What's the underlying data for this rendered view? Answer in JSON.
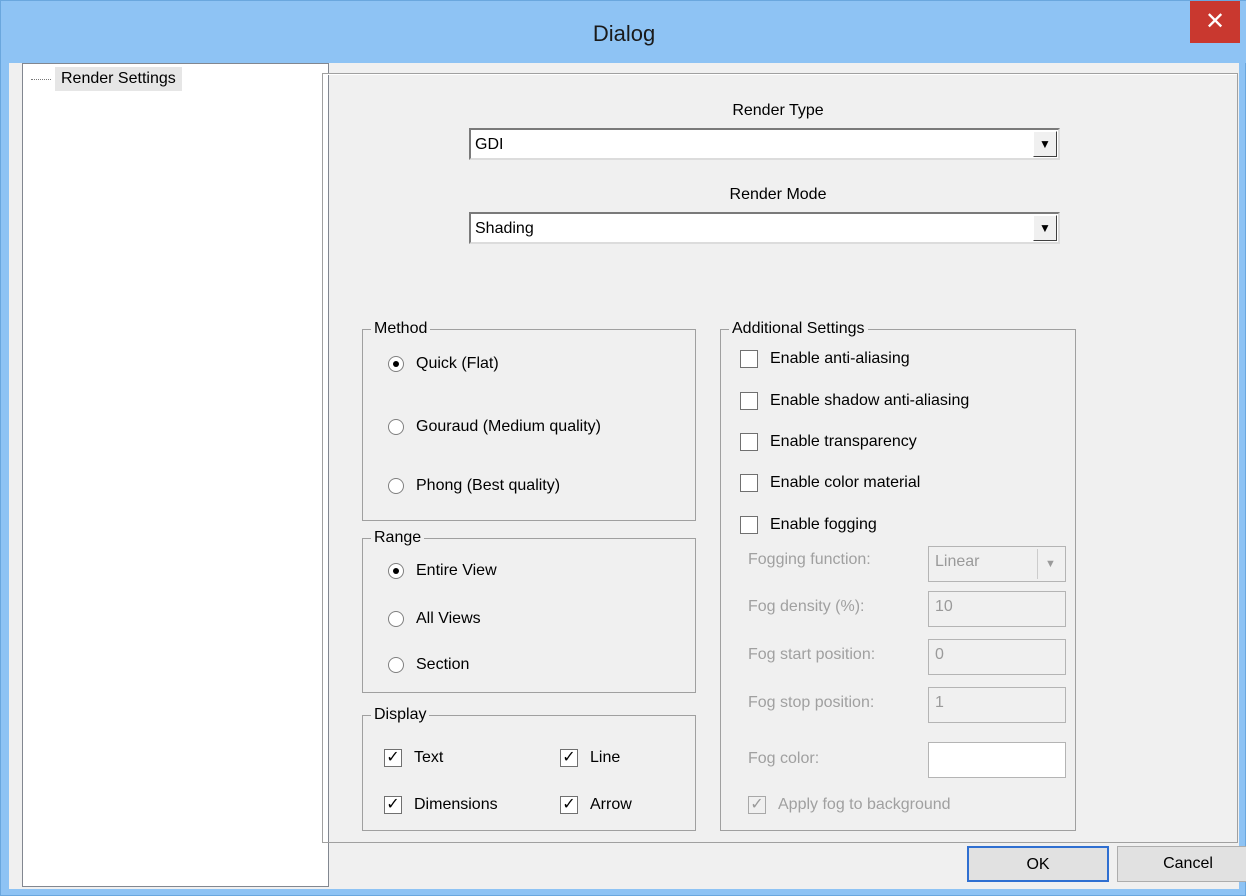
{
  "window": {
    "title": "Dialog",
    "close_label": "✕"
  },
  "tree": {
    "items": [
      {
        "label": "Render Settings"
      }
    ]
  },
  "render": {
    "type_label": "Render Type",
    "type_value": "GDI",
    "mode_label": "Render Mode",
    "mode_value": "Shading"
  },
  "method": {
    "title": "Method",
    "options": [
      {
        "label": "Quick (Flat)",
        "selected": true
      },
      {
        "label": "Gouraud (Medium quality)",
        "selected": false
      },
      {
        "label": "Phong (Best quality)",
        "selected": false
      }
    ]
  },
  "range": {
    "title": "Range",
    "options": [
      {
        "label": "Entire View",
        "selected": true
      },
      {
        "label": "All Views",
        "selected": false
      },
      {
        "label": "Section",
        "selected": false
      }
    ]
  },
  "display": {
    "title": "Display",
    "items": [
      {
        "label": "Text",
        "checked": true
      },
      {
        "label": "Line",
        "checked": true
      },
      {
        "label": "Dimensions",
        "checked": true
      },
      {
        "label": "Arrow",
        "checked": true
      }
    ]
  },
  "additional": {
    "title": "Additional Settings",
    "options": [
      {
        "label": "Enable anti-aliasing",
        "checked": false
      },
      {
        "label": "Enable shadow anti-aliasing",
        "checked": false
      },
      {
        "label": "Enable transparency",
        "checked": false
      },
      {
        "label": "Enable color material",
        "checked": false
      },
      {
        "label": "Enable fogging",
        "checked": false
      }
    ],
    "fog_function_label": "Fogging function:",
    "fog_function_value": "Linear",
    "fog_density_label": "Fog density (%):",
    "fog_density_value": "10",
    "fog_start_label": "Fog start position:",
    "fog_start_value": "0",
    "fog_stop_label": "Fog stop position:",
    "fog_stop_value": "1",
    "fog_color_label": "Fog color:",
    "apply_fog_label": "Apply fog to background"
  },
  "buttons": {
    "ok": "OK",
    "cancel": "Cancel"
  }
}
